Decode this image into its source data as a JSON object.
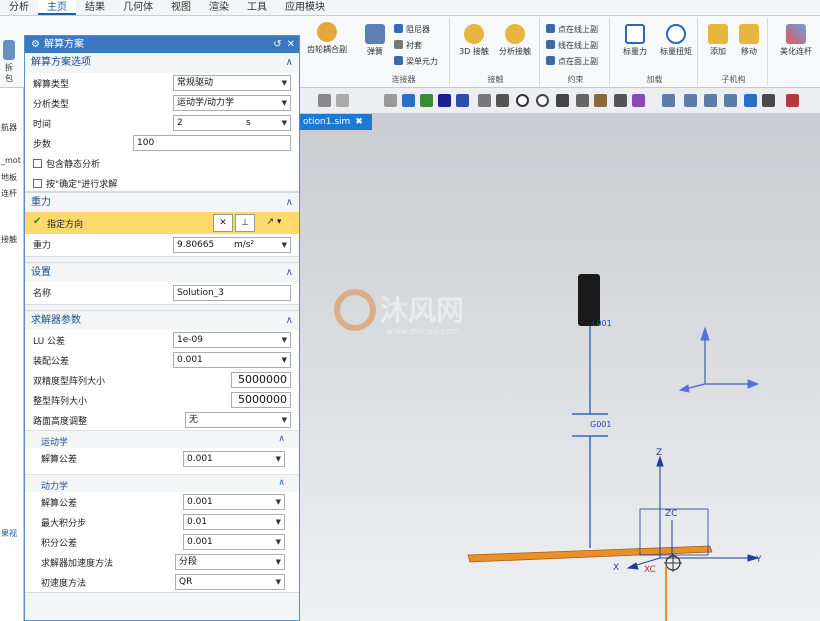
{
  "menu": [
    "分析",
    "主页",
    "结果",
    "几何体",
    "视图",
    "渲染",
    "工具",
    "应用模块"
  ],
  "ribbon": {
    "groups": [
      {
        "label": "连接器",
        "buttons": [
          "弹簧"
        ],
        "small": [
          "阻尼器",
          "衬套",
          "梁单元力"
        ]
      },
      {
        "label": "接触",
        "buttons": [
          "3D 接触",
          "分析接触"
        ]
      },
      {
        "label": "约束",
        "small": [
          "点在线上副",
          "线在线上副",
          "点在面上副"
        ]
      },
      {
        "label": "加载",
        "buttons": [
          "标量力",
          "标量扭矩"
        ]
      },
      {
        "label": "子机构",
        "buttons": [
          "添加",
          "移动"
        ]
      },
      {
        "label": "",
        "buttons": [
          "美化连杆"
        ]
      }
    ],
    "extra_button": "齿轮耦合副",
    "right_cut": "拆包"
  },
  "tab_label": "otion1.sim",
  "leftnav": [
    "航器",
    "_mot",
    "地板",
    "连杆",
    "接触"
  ],
  "left_bottom": "果视",
  "dialog": {
    "title": "解算方案",
    "sections": {
      "options": {
        "title": "解算方案选项",
        "solve_type_label": "解算类型",
        "solve_type_value": "常规驱动",
        "analysis_type_label": "分析类型",
        "analysis_type_value": "运动学/动力学",
        "time_label": "时间",
        "time_value": "2",
        "time_unit": "s",
        "steps_label": "步数",
        "steps_value": "100",
        "static_label": "包含静态分析",
        "ok_label": "按\"确定\"进行求解"
      },
      "gravity": {
        "title": "重力",
        "direction_label": "指定方向",
        "gravity_label": "重力",
        "gravity_value": "9.80665",
        "gravity_unit": "m/s²"
      },
      "settings": {
        "title": "设置",
        "name_label": "名称",
        "name_value": "Solution_3"
      },
      "solver": {
        "title": "求解器参数",
        "lu_label": "LU 公差",
        "lu_value": "1e-09",
        "assembly_label": "装配公差",
        "assembly_value": "0.001",
        "double_label": "双精度型阵列大小",
        "double_value": "5000000",
        "int_label": "整型阵列大小",
        "int_value": "5000000",
        "road_label": "路面高度调整",
        "road_value": "无",
        "kinematics": {
          "title": "运动学",
          "solve_tol_label": "解算公差",
          "solve_tol_value": "0.001"
        },
        "dynamics": {
          "title": "动力学",
          "solve_tol_label": "解算公差",
          "solve_tol_value": "0.001",
          "max_step_label": "最大积分步",
          "max_step_value": "0.01",
          "int_tol_label": "积分公差",
          "int_tol_value": "0.001",
          "accel_label": "求解器加速度方法",
          "accel_value": "分段",
          "init_vel_label": "初速度方法",
          "init_vel_value": "QR"
        }
      }
    }
  },
  "viewport": {
    "label_g001": "G001",
    "label_l001": "L001",
    "axis_z": "Z",
    "axis_zc": "ZC",
    "axis_y": "Y",
    "axis_x": "X",
    "axis_xc": "XC",
    "watermark_main": "沐风网",
    "watermark_url": "www.mfcad.com"
  },
  "colors": {
    "accent": "#3a78bf",
    "highlight": "#fcd96b",
    "tab": "#1c7bd1",
    "plate": "#e8902a",
    "link": "#1f4ea8"
  }
}
